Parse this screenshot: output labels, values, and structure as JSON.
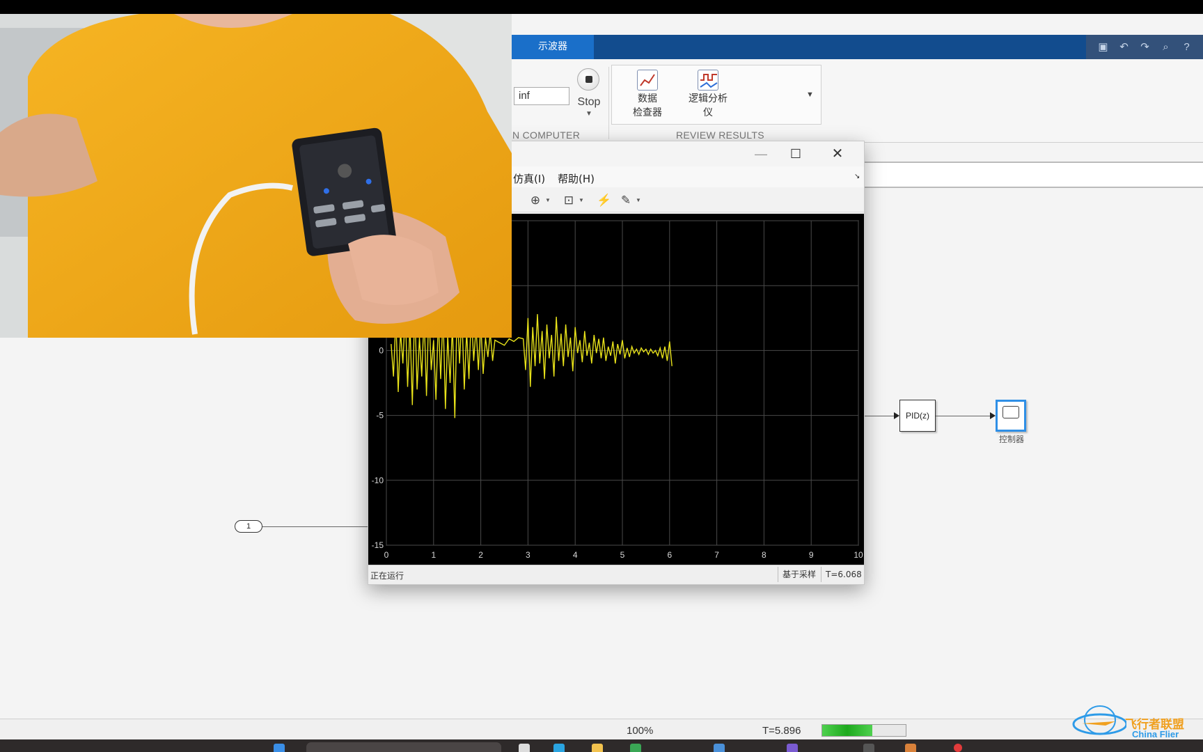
{
  "ribbon": {
    "active_tab": "示波器",
    "stop_time_value": "inf",
    "stop_label": "Stop",
    "section_run": "N COMPUTER",
    "section_review": "REVIEW RESULTS",
    "review_items": [
      {
        "label_line1": "数据",
        "label_line2": "检查器",
        "icon": "data-inspector-icon"
      },
      {
        "label_line1": "逻辑分析",
        "label_line2": "仪",
        "icon": "logic-analyzer-icon"
      }
    ]
  },
  "canvas": {
    "inport_label": "1",
    "pid_label": "PID(z)",
    "scope_caption": "控制器"
  },
  "scope_window": {
    "menu": [
      "仿真(I)",
      "帮助(H)"
    ],
    "status_left": "正在运行",
    "status_mode": "基于采样",
    "status_time": "T=6.068",
    "trace_color": "#e8e21a"
  },
  "chart_data": {
    "type": "line",
    "xlim": [
      0,
      10
    ],
    "ylim": [
      -15,
      10
    ],
    "x_ticks": [
      "0",
      "1",
      "2",
      "3",
      "4",
      "5",
      "6",
      "7",
      "8",
      "9",
      "10"
    ],
    "y_ticks": [
      "0",
      "-5",
      "-10",
      "-15"
    ],
    "grid": true,
    "series": [
      {
        "x": [
          0.1,
          0.15,
          0.2,
          0.25,
          0.3,
          0.35,
          0.4,
          0.45,
          0.5,
          0.55,
          0.6,
          0.65,
          0.7,
          0.75,
          0.8,
          0.85,
          0.9,
          0.95,
          1.0,
          1.05,
          1.1,
          1.15,
          1.2,
          1.25,
          1.3,
          1.35,
          1.4,
          1.45,
          1.5,
          1.55,
          1.6,
          1.65,
          1.7,
          1.75,
          1.8,
          1.85,
          1.9,
          1.95,
          2.0,
          2.05,
          2.1,
          2.15,
          2.2,
          2.25,
          2.3,
          2.4,
          2.5,
          2.6,
          2.7,
          2.8,
          2.9,
          2.95,
          3.0,
          3.05,
          3.1,
          3.15,
          3.2,
          3.25,
          3.3,
          3.35,
          3.4,
          3.45,
          3.5,
          3.55,
          3.6,
          3.65,
          3.7,
          3.75,
          3.8,
          3.85,
          3.9,
          3.95,
          4.0,
          4.05,
          4.1,
          4.15,
          4.2,
          4.25,
          4.3,
          4.35,
          4.4,
          4.45,
          4.5,
          4.55,
          4.6,
          4.65,
          4.7,
          4.75,
          4.8,
          4.85,
          4.9,
          4.95,
          5.0,
          5.05,
          5.1,
          5.15,
          5.2,
          5.25,
          5.3,
          5.35,
          5.4,
          5.45,
          5.5,
          5.55,
          5.6,
          5.65,
          5.7,
          5.75,
          5.8,
          5.85,
          5.9,
          5.95,
          6.0,
          6.05
        ],
        "y": [
          0.5,
          -2.0,
          2.5,
          -3.2,
          1.5,
          -1.0,
          3.0,
          -2.8,
          2.0,
          -4.2,
          3.5,
          -3.0,
          1.0,
          -2.0,
          2.8,
          -3.5,
          3.2,
          -1.5,
          0.8,
          -3.8,
          2.5,
          -2.2,
          3.0,
          -4.5,
          1.2,
          -2.5,
          2.0,
          -5.2,
          3.5,
          -1.0,
          2.8,
          -3.0,
          1.5,
          -2.2,
          3.0,
          -0.8,
          1.8,
          -1.5,
          2.2,
          -1.8,
          1.0,
          -0.5,
          1.4,
          -0.8,
          0.8,
          0.6,
          0.4,
          0.9,
          0.7,
          1.0,
          0.9,
          -1.5,
          2.5,
          -2.8,
          1.8,
          -1.2,
          2.8,
          -1.0,
          1.5,
          -2.2,
          2.0,
          -0.6,
          1.2,
          -2.0,
          2.6,
          -0.8,
          1.3,
          -1.2,
          2.0,
          -0.5,
          1.0,
          -1.6,
          1.8,
          -0.2,
          0.8,
          -0.9,
          1.5,
          -0.4,
          0.6,
          -1.0,
          1.2,
          -0.2,
          0.9,
          -0.6,
          1.0,
          -0.8,
          0.3,
          -0.4,
          0.7,
          -1.0,
          0.5,
          -0.3,
          0.8,
          -0.6,
          0.2,
          -0.5,
          0.3,
          -0.2,
          0.1,
          -0.3,
          0.2,
          -0.1,
          0.1,
          -0.3,
          0.1,
          -0.2,
          0.0,
          -0.4,
          0.2,
          -0.6,
          0.3,
          -0.8,
          0.7,
          -1.2
        ]
      }
    ]
  },
  "statusbar": {
    "zoom": "100%",
    "time": "T=5.896",
    "progress": 0.6
  },
  "watermark": {
    "text_cn": "飞行者联盟",
    "text_en": "China Flier"
  }
}
